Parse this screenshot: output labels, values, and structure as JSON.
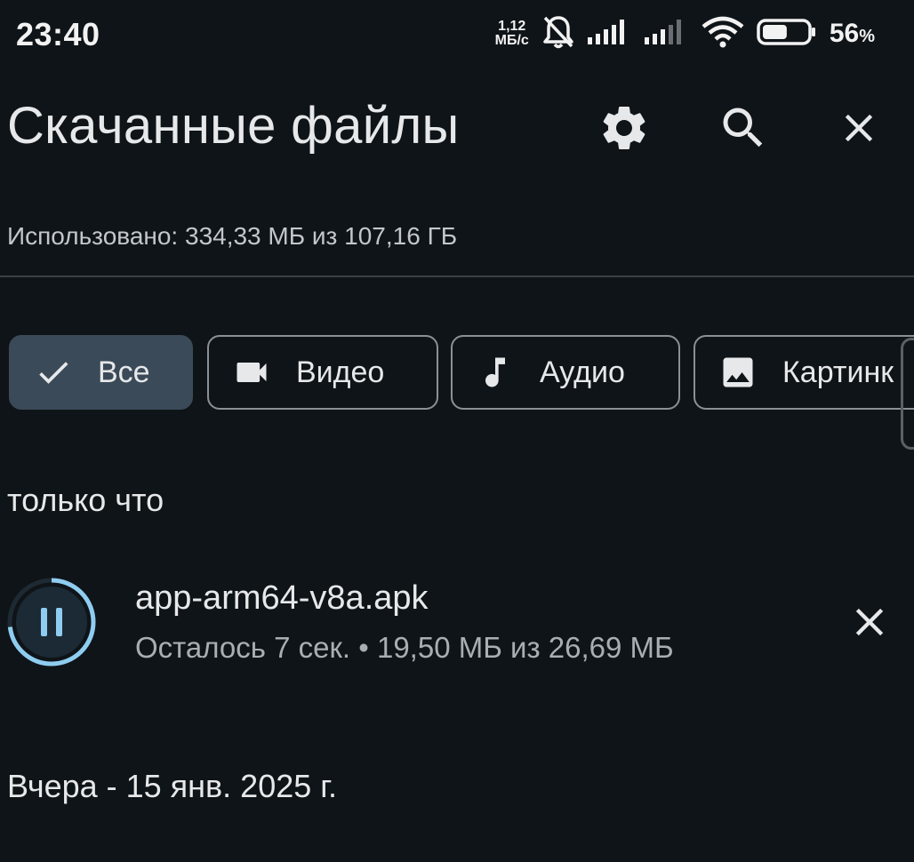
{
  "status_bar": {
    "time": "23:40",
    "net_speed_value": "1,12",
    "net_speed_unit": "МБ/с",
    "battery_percent": "56",
    "battery_percent_sign": "%",
    "battery_level": 0.56,
    "icons": [
      "mute-bell-icon",
      "signal-icon",
      "signal-weak-icon",
      "wifi-icon",
      "battery-icon"
    ]
  },
  "header": {
    "title": "Скачанные файлы",
    "actions": [
      "gear-icon",
      "search-icon",
      "close-icon"
    ]
  },
  "storage": {
    "text": "Использовано: 334,33 МБ из 107,16 ГБ"
  },
  "filters": {
    "chips": [
      {
        "label": "Все",
        "icon": "check-icon",
        "selected": true
      },
      {
        "label": "Видео",
        "icon": "video-icon",
        "selected": false
      },
      {
        "label": "Аудио",
        "icon": "music-note-icon",
        "selected": false
      },
      {
        "label": "Картинк",
        "icon": "image-icon",
        "selected": false
      }
    ]
  },
  "sections": [
    {
      "header": "только что",
      "items": [
        {
          "name": "app-arm64-v8a.apk",
          "status": "Осталось 7 сек. • 19,50 МБ из 26,69 МБ",
          "progress": 0.73,
          "state_icon": "pause-icon",
          "action_icon": "close-icon"
        }
      ]
    },
    {
      "header": "Вчера - 15 янв. 2025 г.",
      "items": []
    }
  ],
  "colors": {
    "background": "#0f1418",
    "accent": "#8fcdf0",
    "chip_selected": "#3b4a58"
  }
}
